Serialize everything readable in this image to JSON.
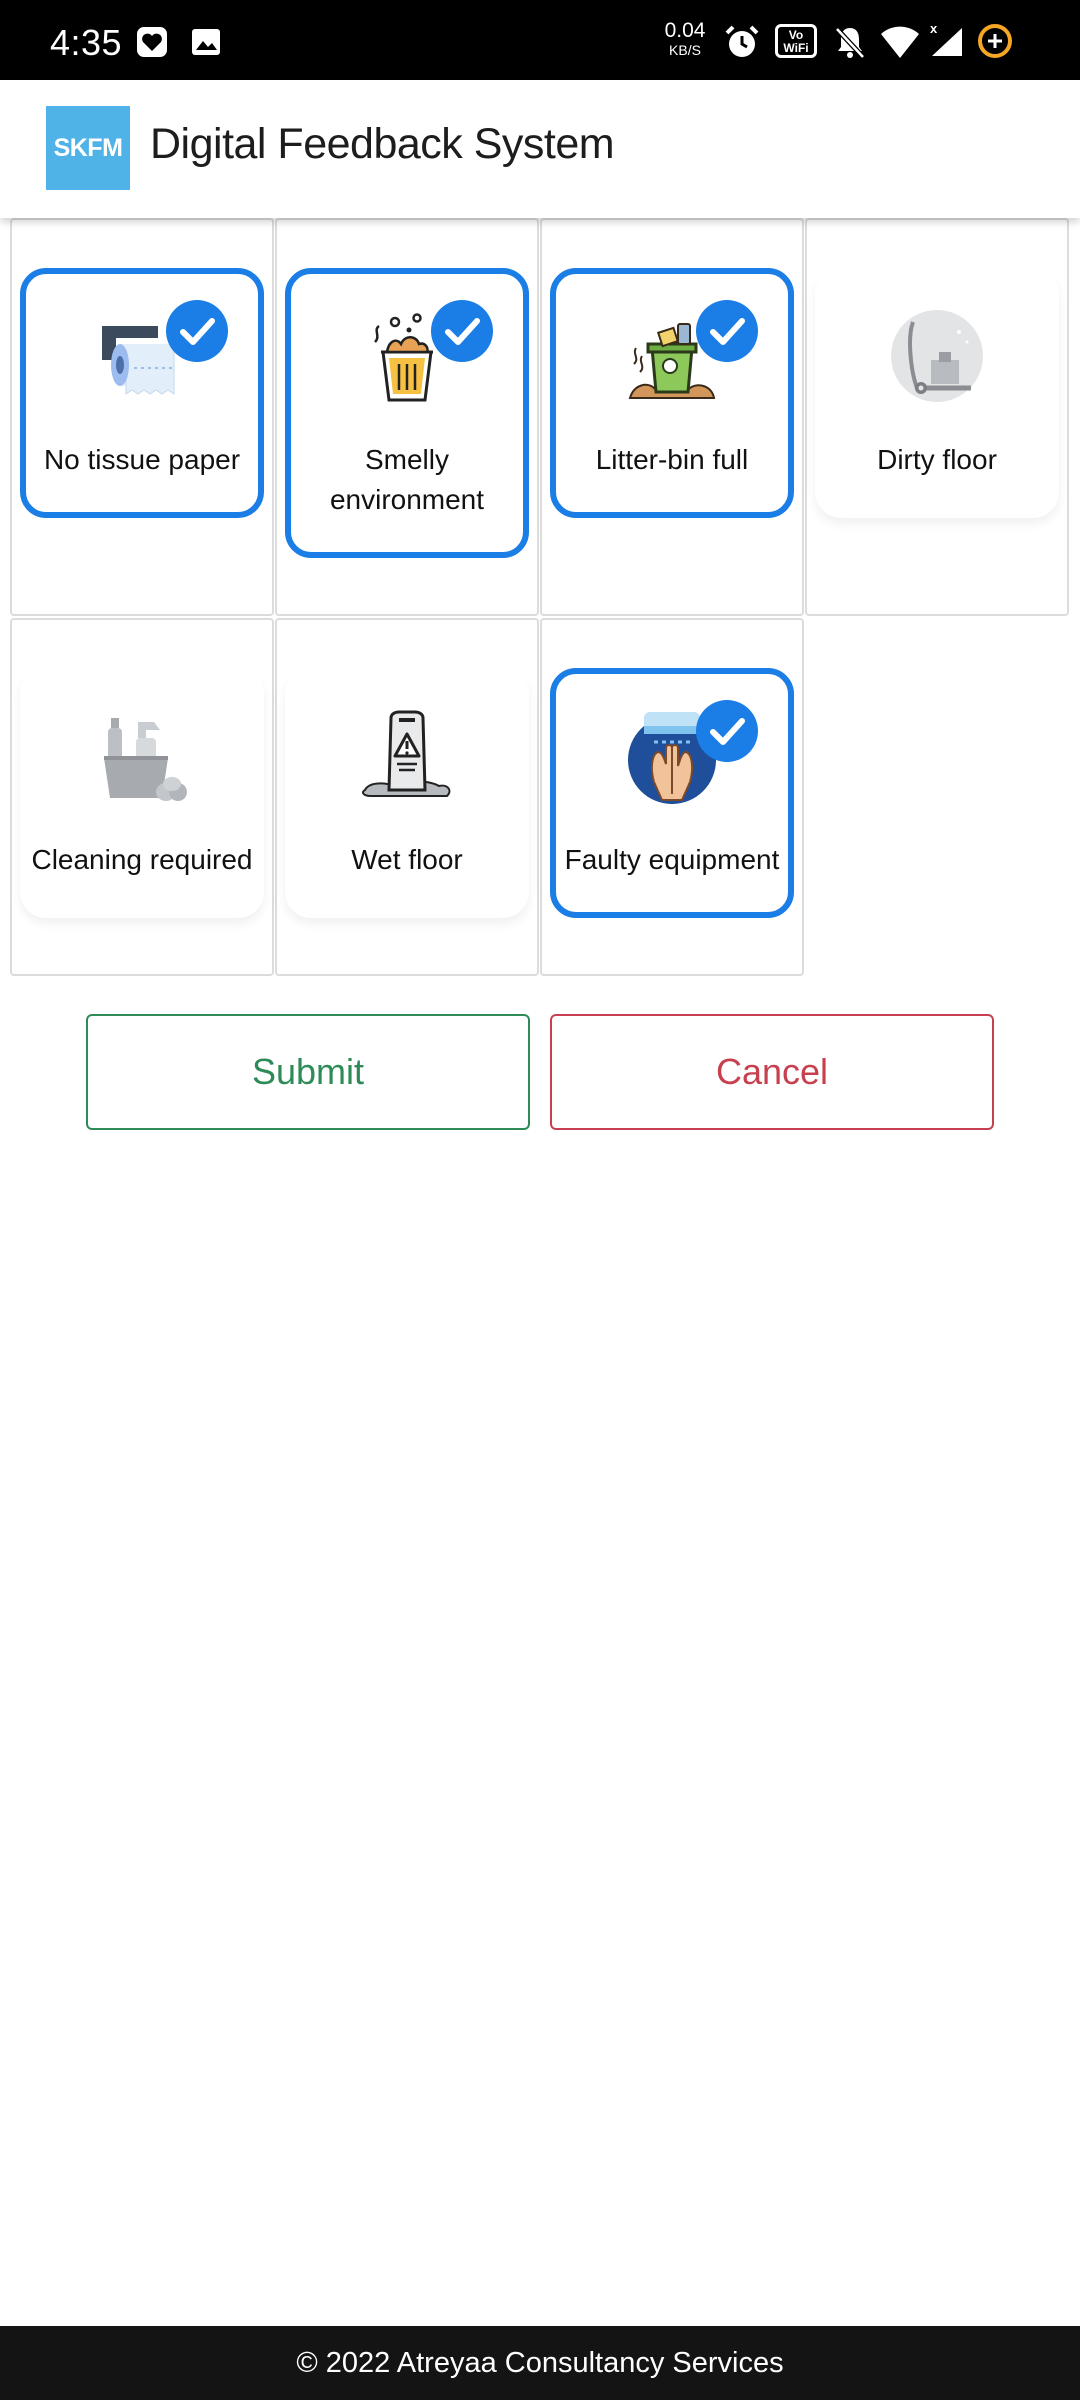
{
  "status_bar": {
    "time": "4:35",
    "net_speed_value": "0.04",
    "net_speed_unit": "KB/S",
    "vowifi_top": "Vo",
    "vowifi_bottom": "WiFi",
    "icons": [
      "heart-notification-icon",
      "image-notification-icon",
      "alarm-icon",
      "vowifi-icon",
      "bell-muted-icon",
      "wifi-icon",
      "cellular-signal-icon",
      "battery-saver-icon"
    ]
  },
  "app_bar": {
    "logo_text": "SKFM",
    "title": "Digital Feedback System"
  },
  "options": [
    {
      "label": "No tissue paper",
      "icon": "tissue-paper-icon",
      "selected": true
    },
    {
      "label": "Smelly environment",
      "icon": "smelly-bin-icon",
      "selected": true
    },
    {
      "label": "Litter-bin full",
      "icon": "litter-bin-icon",
      "selected": true
    },
    {
      "label": "Dirty floor",
      "icon": "floor-mop-icon",
      "selected": false
    },
    {
      "label": "Cleaning required",
      "icon": "cleaning-supplies-icon",
      "selected": false
    },
    {
      "label": "Wet floor",
      "icon": "wet-floor-sign-icon",
      "selected": false
    },
    {
      "label": "Faulty equipment",
      "icon": "hand-dryer-icon",
      "selected": true
    }
  ],
  "actions": {
    "submit_label": "Submit",
    "cancel_label": "Cancel"
  },
  "footer": {
    "text": "© 2022 Atreyaa Consultancy Services"
  },
  "colors": {
    "accent_blue": "#1a7ee6",
    "submit_green": "#2e8b57",
    "cancel_red": "#c8404f",
    "logo_blue": "#4fb3e8",
    "footer_bg": "#141414"
  }
}
